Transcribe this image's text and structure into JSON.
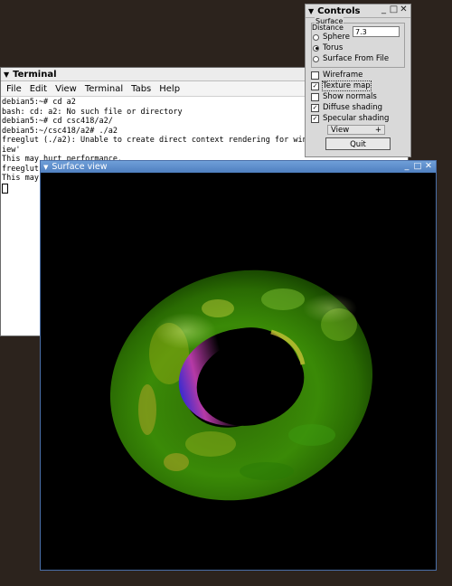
{
  "terminal": {
    "title": "Terminal",
    "menu": [
      "File",
      "Edit",
      "View",
      "Terminal",
      "Tabs",
      "Help"
    ],
    "lines": [
      "debian5:~# cd a2",
      "bash: cd: a2: No such file or directory",
      "debian5:~# cd csc418/a2/",
      "debian5:~/csc418/a2# ./a2",
      "freeglut (./a2): Unable to create direct context rendering for win",
      "iew'",
      "This may hurt performance.",
      "freeglut",
      "This may"
    ]
  },
  "controls": {
    "title": "Controls",
    "surface_label": "Surface",
    "distance_label": "Distance",
    "distance_value": "7.3",
    "radios": [
      {
        "label": "Sphere",
        "selected": false
      },
      {
        "label": "Torus",
        "selected": true
      },
      {
        "label": "Surface From File",
        "selected": false
      }
    ],
    "checkboxes": [
      {
        "label": "Wireframe",
        "checked": false
      },
      {
        "label": "Texture map",
        "checked": true
      },
      {
        "label": "Show normals",
        "checked": false
      },
      {
        "label": "Diffuse shading",
        "checked": true
      },
      {
        "label": "Specular shading",
        "checked": true
      }
    ],
    "view_label": "View",
    "quit_label": "Quit"
  },
  "surface_view": {
    "title": "Surface view"
  },
  "window_buttons": {
    "minimize": "_",
    "maximize": "□",
    "close": "✕"
  }
}
